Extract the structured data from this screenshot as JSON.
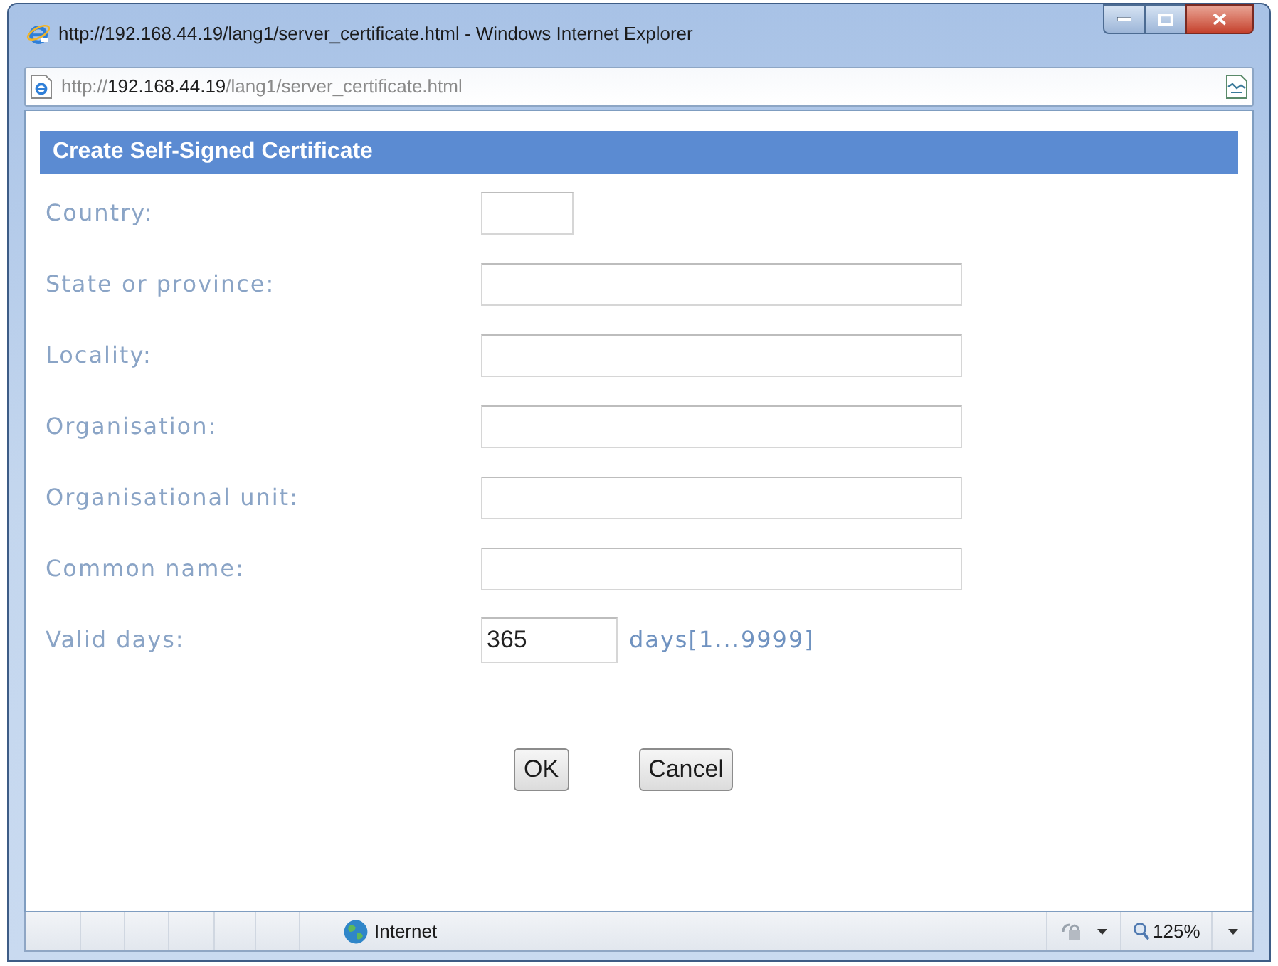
{
  "window": {
    "title": "http://192.168.44.19/lang1/server_certificate.html - Windows Internet Explorer"
  },
  "address_bar": {
    "scheme": "http://",
    "host": "192.168.44.19",
    "path": "/lang1/server_certificate.html"
  },
  "form": {
    "title": "Create Self-Signed Certificate",
    "fields": [
      {
        "kind": "short",
        "label": "Country:"
      },
      {
        "kind": "text",
        "label": "State or province:"
      },
      {
        "kind": "text",
        "label": "Locality:"
      },
      {
        "kind": "text",
        "label": "Organisation:"
      },
      {
        "kind": "text",
        "label": "Organisational unit:"
      },
      {
        "kind": "text",
        "label": "Common name:"
      },
      {
        "kind": "number",
        "label": "Valid days:",
        "value": "365",
        "unit": "days[1...9999]"
      }
    ]
  },
  "buttons": [
    "OK",
    "Cancel"
  ],
  "status_bar": {
    "zone": "Internet",
    "zoom": "125%"
  }
}
